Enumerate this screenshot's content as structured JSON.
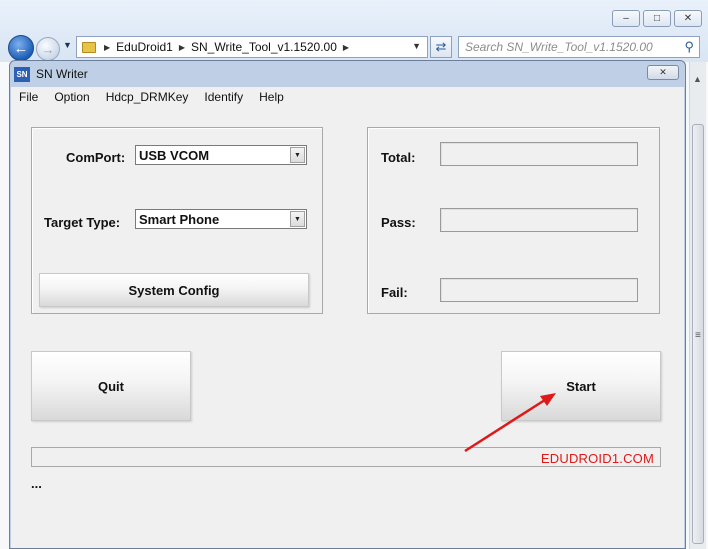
{
  "explorer": {
    "breadcrumb": [
      "EduDroid1",
      "SN_Write_Tool_v1.1520.00"
    ],
    "search_placeholder": "Search SN_Write_Tool_v1.1520.00",
    "icons": [
      "back-arrow-icon",
      "forward-arrow-icon",
      "folder-icon",
      "refresh-icon",
      "search-icon",
      "minimize-icon",
      "maximize-icon",
      "close-icon"
    ]
  },
  "window": {
    "title": "SN Writer"
  },
  "menu": [
    "File",
    "Option",
    "Hdcp_DRMKey",
    "Identify",
    "Help"
  ],
  "config": {
    "comport_label": "ComPort:",
    "comport_value": "USB VCOM",
    "target_label": "Target Type:",
    "target_value": "Smart Phone",
    "system_config_button": "System Config"
  },
  "stats": {
    "total_label": "Total:",
    "pass_label": "Pass:",
    "fail_label": "Fail:",
    "total_value": "",
    "pass_value": "",
    "fail_value": ""
  },
  "actions": {
    "quit": "Quit",
    "start": "Start"
  },
  "status": {
    "watermark": "EDUDROID1.COM",
    "message": "..."
  },
  "colors": {
    "watermark": "#e01818",
    "annotation_arrow": "#e01818"
  }
}
